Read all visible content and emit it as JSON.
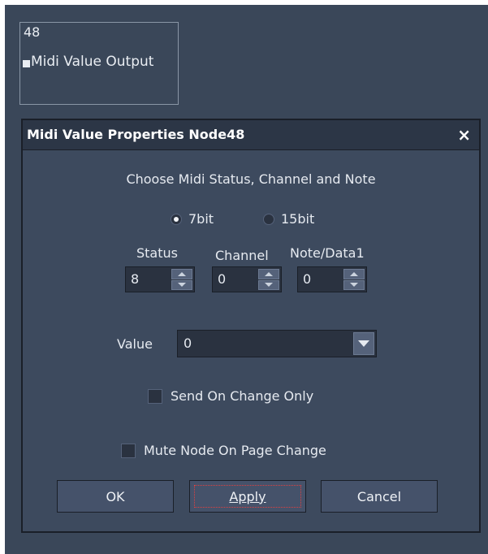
{
  "node": {
    "number": "48",
    "label": "Midi Value Output"
  },
  "dialog": {
    "title": "Midi Value Properties Node48",
    "close_symbol": "×",
    "heading": "Choose Midi Status, Channel and Note",
    "resolution": {
      "options": [
        "7bit",
        "15bit"
      ],
      "selected": "7bit"
    },
    "fields": {
      "status": {
        "label": "Status",
        "value": "8"
      },
      "channel": {
        "label": "Channel",
        "value": "0"
      },
      "note": {
        "label": "Note/Data1",
        "value": "0"
      }
    },
    "value": {
      "label": "Value",
      "selected": "0"
    },
    "send_on_change": {
      "label": "Send On Change Only",
      "checked": false
    },
    "mute_node": {
      "label": "Mute Node On Page Change",
      "checked": false
    },
    "buttons": {
      "ok": "OK",
      "apply": "Apply",
      "cancel": "Cancel"
    }
  },
  "colors": {
    "background": "#3a4759",
    "dialog": "#3d4a5e",
    "titlebar": "#2c3646",
    "field": "#2a3240",
    "button": "#45526a"
  }
}
